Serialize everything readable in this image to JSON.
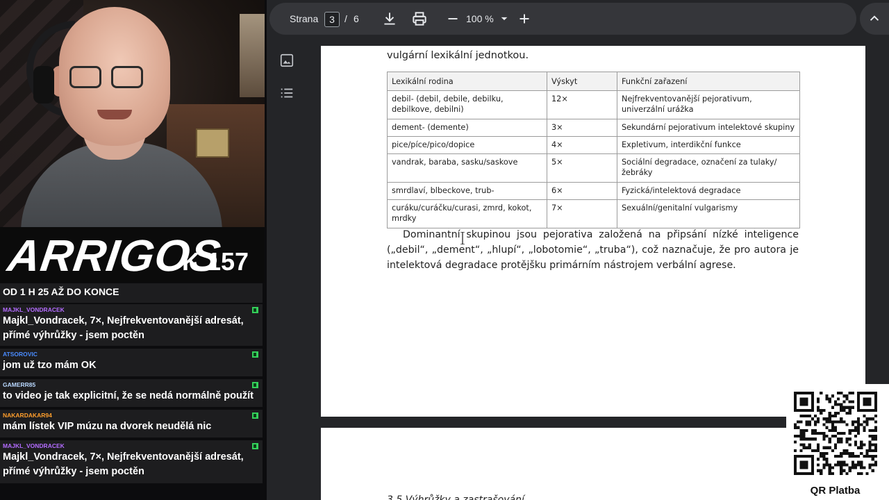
{
  "stream": {
    "brand_name": "ARRIGOS",
    "brand_number": "K 157",
    "chat_header": "OD 1 H 25 AŽ DO KONCE",
    "chat_messages": [
      {
        "user": "MAJKL_VONDRACEK",
        "user_color": "#b46cff",
        "text": "Majkl_Vondracek, 7×, Nejfrekventovanější adresát, přímé výhrůžky - jsem poctěn"
      },
      {
        "user": "ATSOROVIC",
        "user_color": "#4a8cff",
        "text": "jom už tzo mám OK"
      },
      {
        "user": "GAMERR85",
        "user_color": "#b9d8ff",
        "text": "to video je tak explicitní, že se nedá normálně použít"
      },
      {
        "user": "NAKARDAKAR94",
        "user_color": "#ff9e2c",
        "text": "mám lístek VIP múzu na dvorek neudělá nic"
      },
      {
        "user": "MAJKL_VONDRACEK",
        "user_color": "#b46cff",
        "text": "Majkl_Vondracek, 7×, Nejfrekventovanější adresát, přímé výhrůžky - jsem poctěn"
      }
    ],
    "qr_label": "QR Platba"
  },
  "viewer": {
    "toolbar": {
      "page_label": "Strana",
      "current_page": "3",
      "separator": "/",
      "total_pages": "6",
      "zoom": "100 %",
      "icons": [
        "download-icon",
        "print-icon",
        "zoom-out-icon",
        "zoom-in-icon",
        "collapse-icon"
      ]
    },
    "sidebar_icons": [
      "thumbnails-icon",
      "outline-icon"
    ],
    "page": {
      "intro_line": "vulgární lexikální jednotkou.",
      "table": {
        "headers": [
          "Lexikální rodina",
          "Výskyt",
          "Funkční zařazení"
        ],
        "rows": [
          [
            "debil- (debil, debile, debilku, debilkove, debilni)",
            "12×",
            "Nejfrekventovanější pejorativum, univerzální urážka"
          ],
          [
            "dement- (demente)",
            "3×",
            "Sekundární pejorativum intelektové skupiny"
          ],
          [
            "pice/píce/pico/dopice",
            "4×",
            "Expletivum, interdikční funkce"
          ],
          [
            "vandrak, baraba, sasku/saskove",
            "5×",
            "Sociální degradace, označení za tulaky/žebráky"
          ],
          [
            "smrdlaví, blbeckove, trub-",
            "6×",
            "Fyzická/intelektová degradace"
          ],
          [
            "curáku/curáčku/curasi, zmrd, kokot, mrdky",
            "7×",
            "Sexuální/genitalní vulgarismy"
          ]
        ]
      },
      "paragraph": "Dominantní skupinou jsou pejorativa založená na připsání nízké inteligence („debil“, „dement“, „hlupí“, „lobotomie“, „truba“), což naznačuje, že pro autora je intelektová degradace protějšku primárním nástrojem verbální agrese."
    },
    "next_page": {
      "heading_partial": "3.5 Výhrůžky a zastrašování"
    }
  }
}
